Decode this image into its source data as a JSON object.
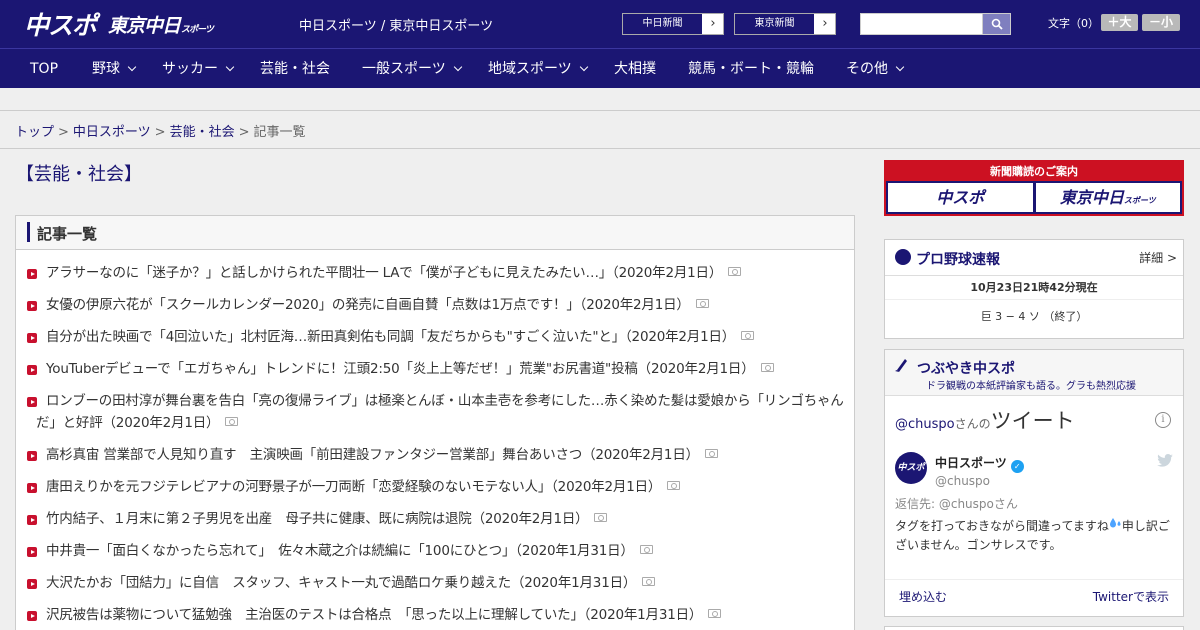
{
  "header": {
    "logo_main": "中スポ",
    "logo_tokyo": "東京中日",
    "logo_tokyo_suffix": "スポーツ",
    "site_sub": "中日スポーツ / 東京中日スポーツ",
    "paper_chunichi": "中日新聞",
    "paper_tokyo": "東京新聞",
    "search_placeholder": "",
    "fontsize_label": "文字（0）",
    "fontsize_large": "＋大",
    "fontsize_small": "－小"
  },
  "nav": [
    {
      "label": "TOP",
      "dropdown": false
    },
    {
      "label": "野球",
      "dropdown": true
    },
    {
      "label": "サッカー",
      "dropdown": true
    },
    {
      "label": "芸能・社会",
      "dropdown": false
    },
    {
      "label": "一般スポーツ",
      "dropdown": true
    },
    {
      "label": "地域スポーツ",
      "dropdown": true
    },
    {
      "label": "大相撲",
      "dropdown": false
    },
    {
      "label": "競馬・ボート・競輪",
      "dropdown": false
    },
    {
      "label": "その他",
      "dropdown": true
    }
  ],
  "breadcrumb": {
    "items": [
      "トップ",
      "中日スポーツ",
      "芸能・社会"
    ],
    "current": "記事一覧",
    "separator": ">"
  },
  "page_title": "【芸能・社会】",
  "article_section_title": "記事一覧",
  "articles": [
    {
      "text": "アラサーなのに「迷子か？」と話しかけられた平間壮一 LAで「僕が子どもに見えたみたい…」（2020年2月1日）"
    },
    {
      "text": "女優の伊原六花が「スクールカレンダー2020」の発売に自画自賛「点数は1万点です！」（2020年2月1日）"
    },
    {
      "text": "自分が出た映画で「4回泣いた」北村匠海…新田真剣佑も同調「友だちからも\"すごく泣いた\"と」（2020年2月1日）"
    },
    {
      "text": "YouTuberデビューで「エガちゃん」トレンドに！江頭2:50「炎上上等だぜ！」荒業\"お尻書道\"投稿（2020年2月1日）"
    },
    {
      "text": "ロンブーの田村淳が舞台裏を告白「亮の復帰ライブ」は極楽とんぼ・山本圭壱を参考にした…赤く染めた髪は愛娘から「リンゴちゃんだ」と好評（2020年2月1日）"
    },
    {
      "text": "高杉真宙 営業部で人見知り直す　主演映画「前田建設ファンタジー営業部」舞台あいさつ（2020年2月1日）"
    },
    {
      "text": "唐田えりかを元フジテレビアナの河野景子が一刀両断「恋愛経験のないモテない人」（2020年2月1日）"
    },
    {
      "text": "竹内結子、１月末に第２子男児を出産　母子共に健康、既に病院は退院（2020年2月1日）"
    },
    {
      "text": "中井貴一「面白くなかったら忘れて」　佐々木蔵之介は続編に「100にひとつ」（2020年1月31日）"
    },
    {
      "text": "大沢たかお「団結力」に自信　スタッフ、キャスト一丸で過酷ロケ乗り越えた（2020年1月31日）"
    },
    {
      "text": "沢尻被告は薬物について猛勉強　主治医のテストは合格点　「思った以上に理解していた」（2020年1月31日）"
    }
  ],
  "sidebar": {
    "subscribe_title": "新聞購読のご案内",
    "subscribe_logo1": "中スポ",
    "subscribe_logo2": "東京中日",
    "subscribe_logo2_suffix": "スポーツ",
    "baseball_title": "プロ野球速報",
    "baseball_more": "詳細 >",
    "baseball_time": "10月23日21時42分現在",
    "baseball_score": "巨 3 − 4 ソ （終了）",
    "tweets_title": "つぶやき中スポ",
    "tweets_sub": "ドラ観戦の本紙評論家も語る。グラも熱烈応援",
    "tweet_account": "@chuspo",
    "tweet_account_suffix": "さんの",
    "tweet_word": "ツイート",
    "tweet_name": "中日スポーツ",
    "tweet_handle": "@chuspo",
    "tweet_reply": "返信先: @chuspoさん",
    "tweet_body_1": "タグを打っておきながら間違ってますね",
    "tweet_body_2": "申し訳ございません。ゴンサレスです。",
    "tweet_embed": "埋め込む",
    "tweet_view": "Twitterで表示"
  },
  "colors": {
    "brand": "#1b1673",
    "accent_red": "#c8102e",
    "twitter_blue": "#1da1f2"
  }
}
